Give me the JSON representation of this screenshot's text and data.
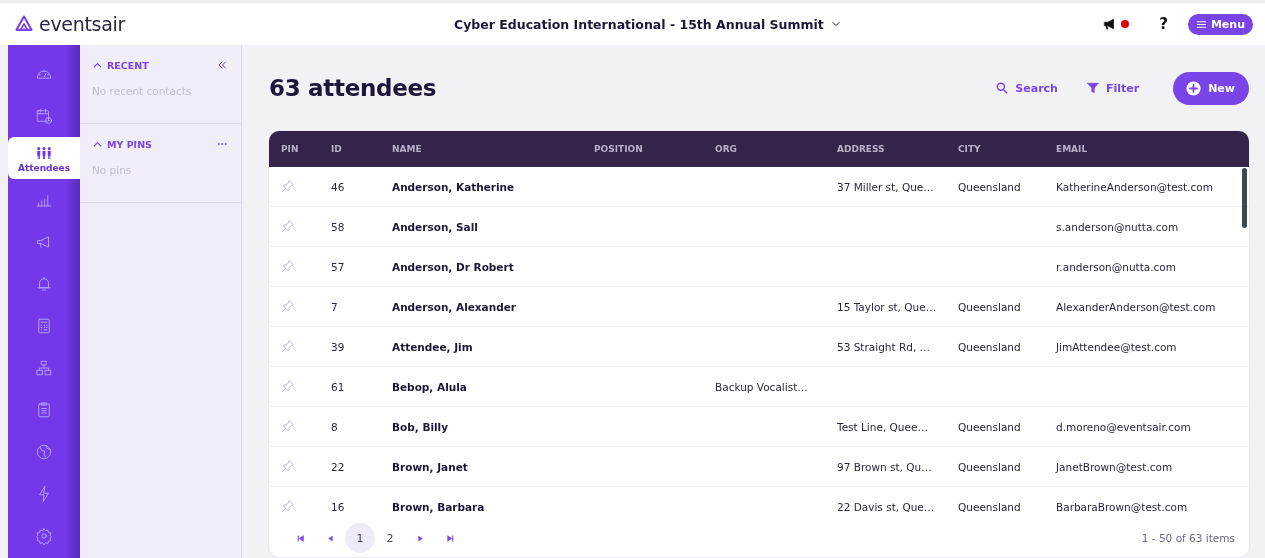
{
  "header": {
    "logo": "eventsair",
    "event_title": "Cyber Education International - 15th Annual Summit",
    "has_notification": true,
    "help": "?",
    "menu_button": "Menu"
  },
  "rail": [
    {
      "kind": "gauge",
      "selected": false
    },
    {
      "kind": "calendar",
      "selected": false
    },
    {
      "kind": "people",
      "label": "Attendees",
      "selected": true
    },
    {
      "kind": "chart",
      "selected": false
    },
    {
      "kind": "megaphone",
      "selected": false
    },
    {
      "kind": "bell",
      "selected": false
    },
    {
      "kind": "calculator",
      "selected": false
    },
    {
      "kind": "hierarchy",
      "selected": false
    },
    {
      "kind": "clipboard",
      "selected": false
    },
    {
      "kind": "globe",
      "selected": false
    },
    {
      "kind": "bolt",
      "selected": false
    },
    {
      "kind": "gear",
      "selected": false
    }
  ],
  "panel": {
    "sections": [
      {
        "title": "RECENT",
        "expanded": true,
        "kind": "collapse",
        "empty_text": "No recent contacts"
      },
      {
        "title": "MY PINS",
        "expanded": true,
        "kind": "more",
        "empty_text": "No pins"
      }
    ]
  },
  "page": {
    "title": "63 attendees",
    "actions": [
      {
        "kind": "search",
        "label": "Search"
      },
      {
        "kind": "filter",
        "label": "Filter"
      },
      {
        "kind": "new",
        "label": "New"
      }
    ]
  },
  "table": {
    "columns": [
      {
        "label": "PIN",
        "kind": "pin"
      },
      {
        "label": "ID",
        "kind": "id"
      },
      {
        "label": "NAME",
        "kind": "name"
      },
      {
        "label": "POSITION",
        "kind": "position"
      },
      {
        "label": "ORG",
        "kind": "org"
      },
      {
        "label": "ADDRESS",
        "kind": "address"
      },
      {
        "label": "CITY",
        "kind": "city"
      },
      {
        "label": "EMAIL",
        "kind": "email"
      }
    ],
    "rows": [
      {
        "id": "46",
        "name": "Anderson, Katherine",
        "address": "37 Miller st, Que…",
        "city": "Queensland",
        "email": "KatherineAnderson@test.com"
      },
      {
        "id": "58",
        "name": "Anderson, Sall",
        "email": "s.anderson@nutta.com"
      },
      {
        "id": "57",
        "name": "Anderson, Dr Robert",
        "email": "r.anderson@nutta.com"
      },
      {
        "id": "7",
        "name": "Anderson, Alexander",
        "address": "15 Taylor st, Que…",
        "city": "Queensland",
        "email": "AlexanderAnderson@test.com"
      },
      {
        "id": "39",
        "name": "Attendee, Jim",
        "address": "53 Straight Rd, …",
        "city": "Queensland",
        "email": "JimAttendee@test.com"
      },
      {
        "id": "61",
        "name": "Bebop, Alula",
        "org": "Backup Vocalist…"
      },
      {
        "id": "8",
        "name": "Bob, Billy",
        "address": "Test Line, Quee…",
        "city": "Queensland",
        "email": "d.moreno@eventsair.com"
      },
      {
        "id": "22",
        "name": "Brown, Janet",
        "address": "97 Brown st, Qu…",
        "city": "Queensland",
        "email": "JanetBrown@test.com"
      },
      {
        "id": "16",
        "name": "Brown, Barbara",
        "address": "22 Davis st, Que…",
        "city": "Queensland",
        "email": "BarbaraBrown@test.com"
      }
    ]
  },
  "pagination": {
    "pages": [
      {
        "label": "1",
        "selected": true
      },
      {
        "label": "2",
        "selected": false
      }
    ],
    "summary": "1 - 50 of 63 items"
  }
}
